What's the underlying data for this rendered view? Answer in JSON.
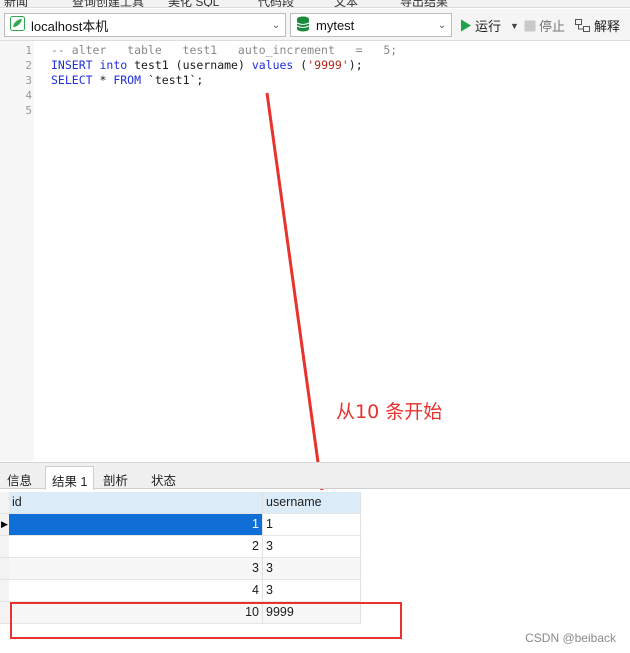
{
  "toolbar_top": {
    "fragments": [
      "新闻",
      "查询创建工具",
      "美化 SQL",
      "代码段",
      "文本",
      "导出结果"
    ]
  },
  "connection": {
    "label": "localhost本机",
    "color": "#2fa84f"
  },
  "database": {
    "label": "mytest",
    "color": "#1c8a3e"
  },
  "actions": {
    "run_label": "运行",
    "stop_label": "停止",
    "explain_label": "解释",
    "run_color": "#1fa34a"
  },
  "editor": {
    "line_numbers": [
      "1",
      "2",
      "3",
      "4",
      "5"
    ],
    "line1": {
      "comment": "-- alter   table   test1   auto_increment   =   5;"
    },
    "line2": {
      "kw1": "INSERT",
      "sp1": " ",
      "kw2": "into",
      "txt": " test1 (username) ",
      "kw3": "values",
      "sp2": " (",
      "str": "'9999'",
      "end": ");"
    },
    "line3": {
      "kw1": "SELECT",
      "txt": " * ",
      "kw2": "FROM",
      "end": " `test1`;"
    }
  },
  "annotation": {
    "text": "从10 条开始",
    "color": "#e8322d"
  },
  "result_tabs": [
    "信息",
    "结果 1",
    "剖析",
    "状态"
  ],
  "result_grid": {
    "columns": [
      "id",
      "username"
    ],
    "rows": [
      [
        "1",
        "1"
      ],
      [
        "2",
        "3"
      ],
      [
        "3",
        "3"
      ],
      [
        "4",
        "3"
      ],
      [
        "10",
        "9999"
      ]
    ],
    "selected_color": "#0f6fd6"
  },
  "watermark": "CSDN @beiback"
}
